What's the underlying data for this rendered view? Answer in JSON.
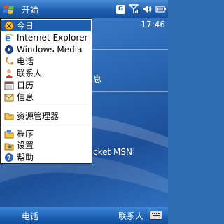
{
  "titlebar": {
    "title": "开始",
    "badge_letter": "G",
    "icons": [
      "start-logo-icon",
      "g-badge-icon",
      "signal-icon",
      "speaker-icon",
      "battery-icon"
    ]
  },
  "today": {
    "clock": "17:46",
    "line1": "息",
    "line2": "cket MSN!"
  },
  "start_menu": {
    "items": [
      {
        "label": "今日",
        "icon": "today-icon",
        "selected": true
      },
      {
        "label": "Internet Explorer",
        "icon": "ie-icon"
      },
      {
        "label": "Windows Media",
        "icon": "media-icon"
      },
      {
        "label": "电话",
        "icon": "phone-icon"
      },
      {
        "label": "联系人",
        "icon": "contacts-icon"
      },
      {
        "label": "日历",
        "icon": "calendar-icon"
      },
      {
        "label": "信息",
        "icon": "messaging-icon"
      },
      {
        "label": "资源管理器",
        "icon": "explorer-icon"
      },
      {
        "label": "程序",
        "icon": "programs-icon"
      },
      {
        "label": "设置",
        "icon": "settings-icon"
      },
      {
        "label": "帮助",
        "icon": "help-icon"
      }
    ]
  },
  "softkeys": {
    "left": "电话",
    "right": "联系人"
  },
  "colors": {
    "accent": "#1f5fb0",
    "menu_bg": "#ffffff"
  }
}
